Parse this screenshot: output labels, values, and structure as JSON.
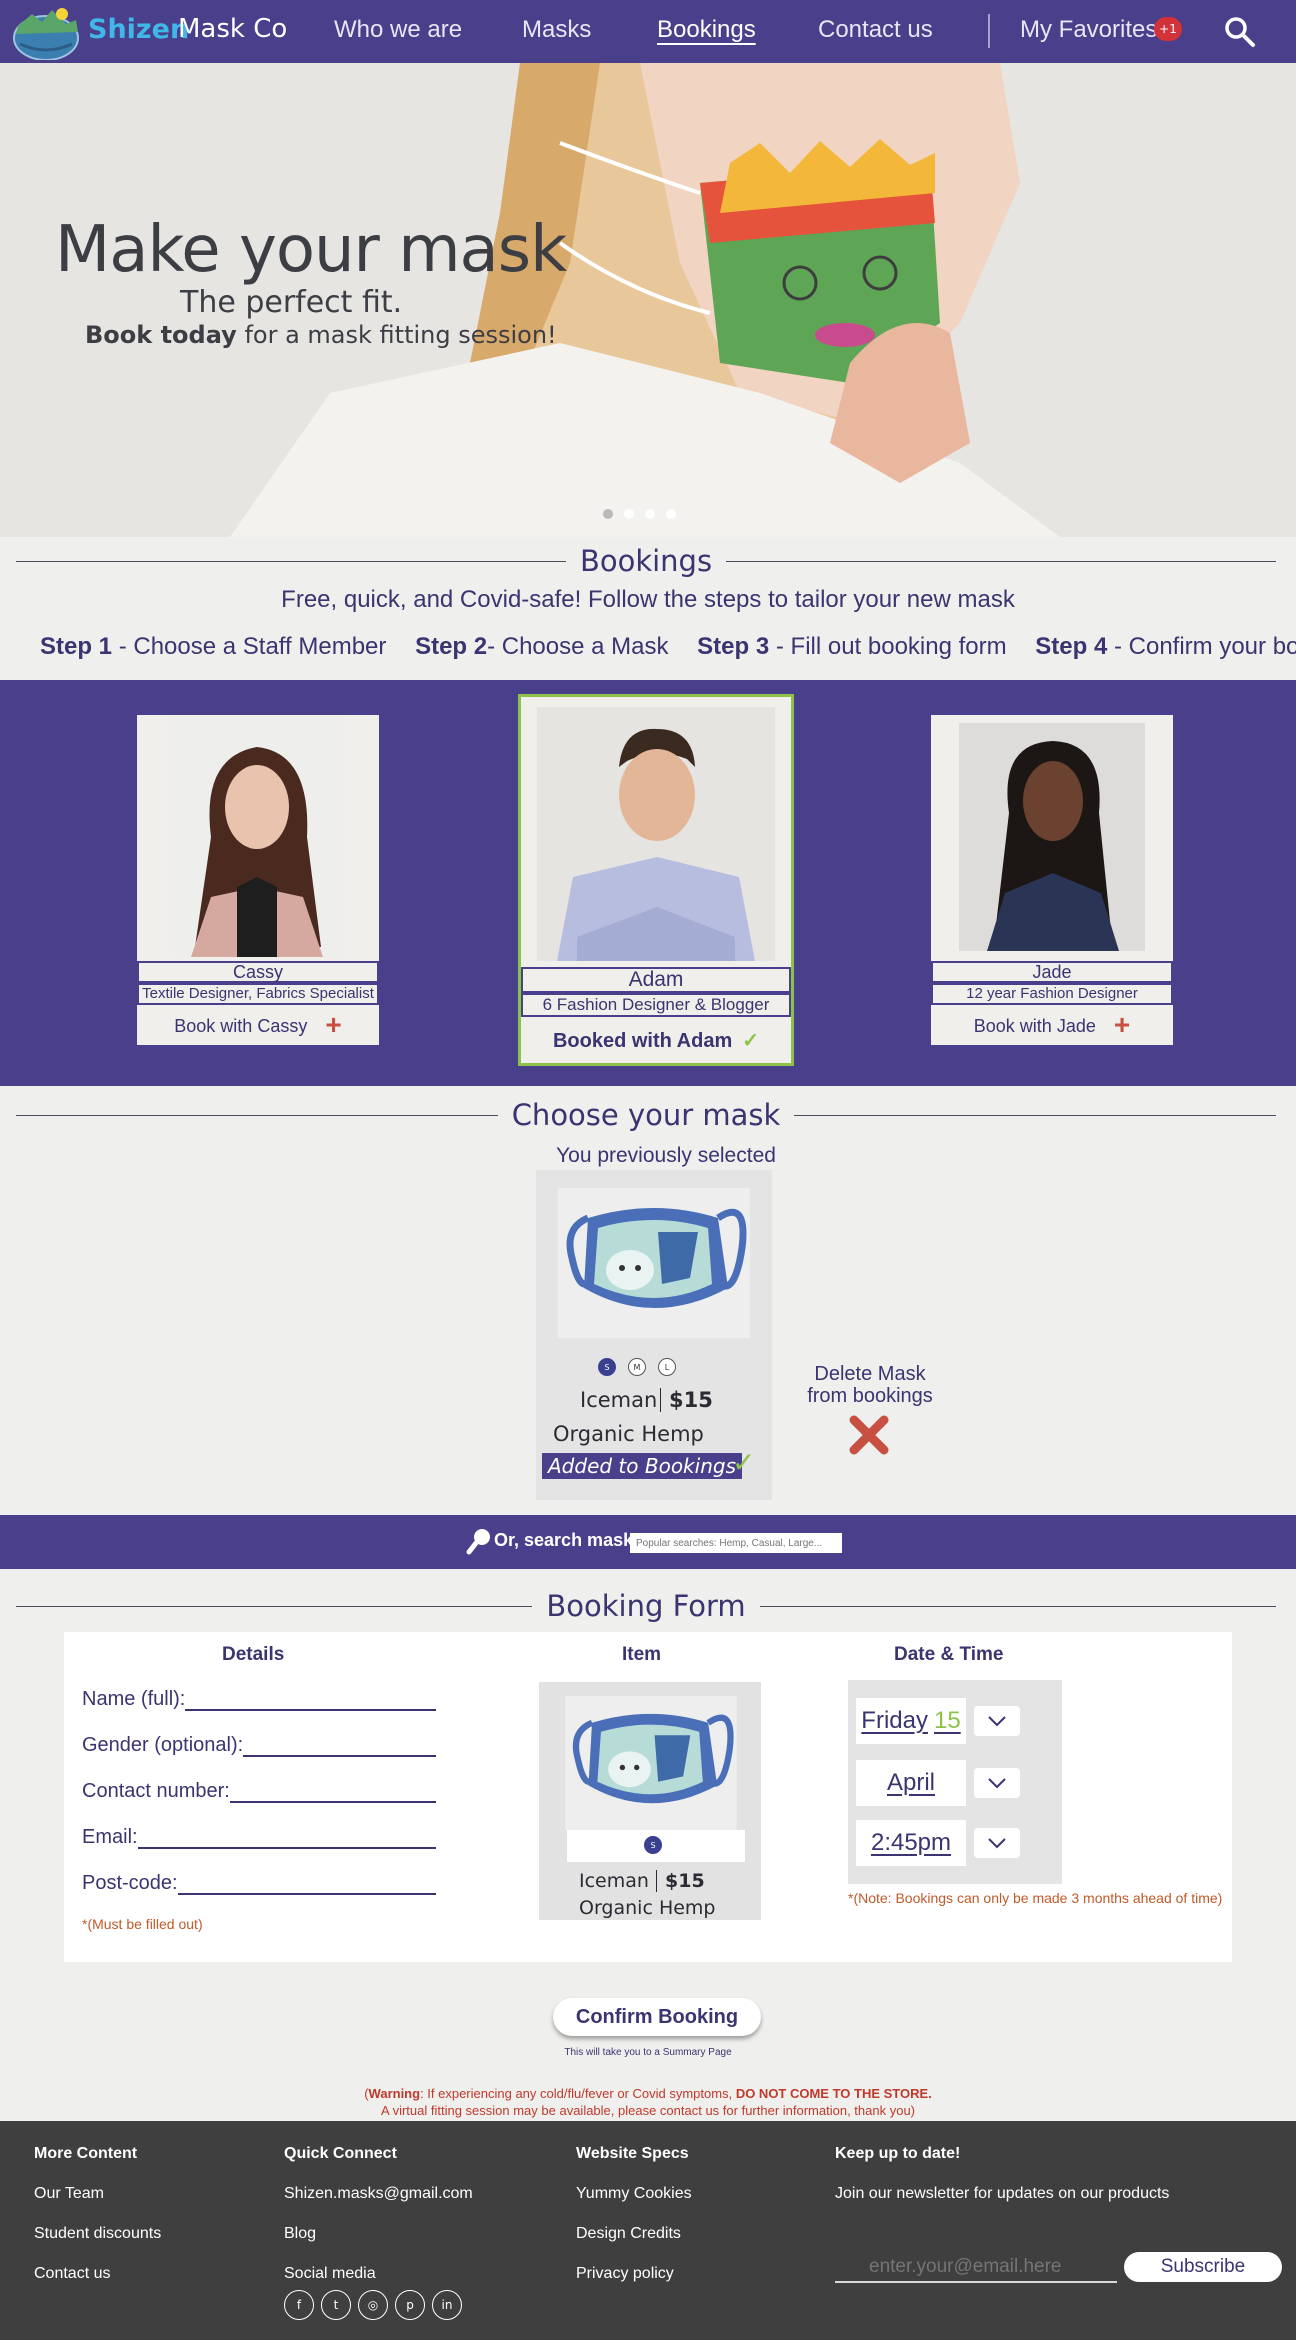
{
  "nav": {
    "brand_primary": "Shizen",
    "brand_secondary": "Mask Co",
    "links": [
      "Who we are",
      "Masks",
      "Bookings",
      "Contact us"
    ],
    "active_link": "Bookings",
    "favorites_label": "My Favorites",
    "favorites_badge": "+1"
  },
  "hero": {
    "title": "Make your mask",
    "subtitle": "The perfect fit.",
    "cta_bold": "Book today",
    "cta_rest": " for a mask fitting session!",
    "slide_count": 4,
    "active_slide": 1
  },
  "bookings": {
    "heading": "Bookings",
    "subheading": "Free, quick, and Covid-safe! Follow the steps to tailor your new mask",
    "steps": [
      {
        "num": "Step 1",
        "text": " - Choose a Staff Member"
      },
      {
        "num": "Step 2",
        "text": "- Choose a Mask"
      },
      {
        "num": "Step 3",
        "text": " - Fill out booking form"
      },
      {
        "num": "Step 4",
        "text": " - Confirm your booking"
      }
    ]
  },
  "staff": [
    {
      "name": "Cassy",
      "role": "Textile Designer, Fabrics Specialist",
      "action": "Book with Cassy",
      "selected": false
    },
    {
      "name": "Adam",
      "role": "6 Fashion Designer & Blogger",
      "action": "Booked with Adam",
      "selected": true
    },
    {
      "name": "Jade",
      "role": "12 year Fashion Designer",
      "action": "Book with Jade",
      "selected": false
    }
  ],
  "mask_section": {
    "heading": "Choose your mask",
    "previously": "You previously selected",
    "sizes": [
      "S",
      "M",
      "L"
    ],
    "selected_size": "S",
    "name": "Iceman",
    "price": "$15",
    "material": "Organic Hemp",
    "added_label": "Added to Bookings",
    "delete_label": "Delete Mask from bookings"
  },
  "search": {
    "label": "Or, search masks",
    "placeholder": "Popular searches: Hemp, Casual, Large..."
  },
  "form": {
    "heading": "Booking Form",
    "details_heading": "Details",
    "item_heading": "Item",
    "datetime_heading": "Date & Time",
    "fields": [
      "Name (full):",
      "Gender (optional):",
      "Contact number:",
      "Email:",
      "Post-code:"
    ],
    "must_note": "*(Must be filled out)",
    "item_size": "S",
    "item_name": "Iceman",
    "item_price": "$15",
    "item_material": "Organic Hemp",
    "day_name": "Friday",
    "day_num": "15",
    "month": "April",
    "time": "2:45pm",
    "note": "*(Note: Bookings can only be made 3 months ahead of time)"
  },
  "confirm": {
    "button": "Confirm Booking",
    "note": "This will take you to a Summary Page"
  },
  "warning": {
    "open": "(",
    "bold": "Warning",
    "text": ": If experiencing any cold/flu/fever or Covid symptoms, ",
    "bold2": "DO NOT COME TO THE STORE.",
    "line2": "A virtual fitting session may be available, please contact us for further information, thank you)"
  },
  "footer": {
    "more": {
      "heading": "More Content",
      "links": [
        "Our Team",
        "Student discounts",
        "Contact us"
      ]
    },
    "quick": {
      "heading": "Quick Connect",
      "links": [
        "Shizen.masks@gmail.com",
        "Blog",
        "Social media"
      ]
    },
    "specs": {
      "heading": "Website Specs",
      "links": [
        "Yummy Cookies",
        "Design Credits",
        "Privacy policy"
      ]
    },
    "news": {
      "heading": "Keep up to date!",
      "text": "Join our newsletter for updates on our products",
      "placeholder": "enter.your@email.here",
      "button": "Subscribe"
    },
    "social_icons": [
      "facebook-icon",
      "twitter-icon",
      "instagram-icon",
      "pinterest-icon",
      "linkedin-icon"
    ]
  },
  "colors": {
    "brand_purple": "#4a3f8a",
    "accent_green": "#8bc34a",
    "accent_red": "#c85040",
    "footer_bg": "#3f3f3f"
  }
}
